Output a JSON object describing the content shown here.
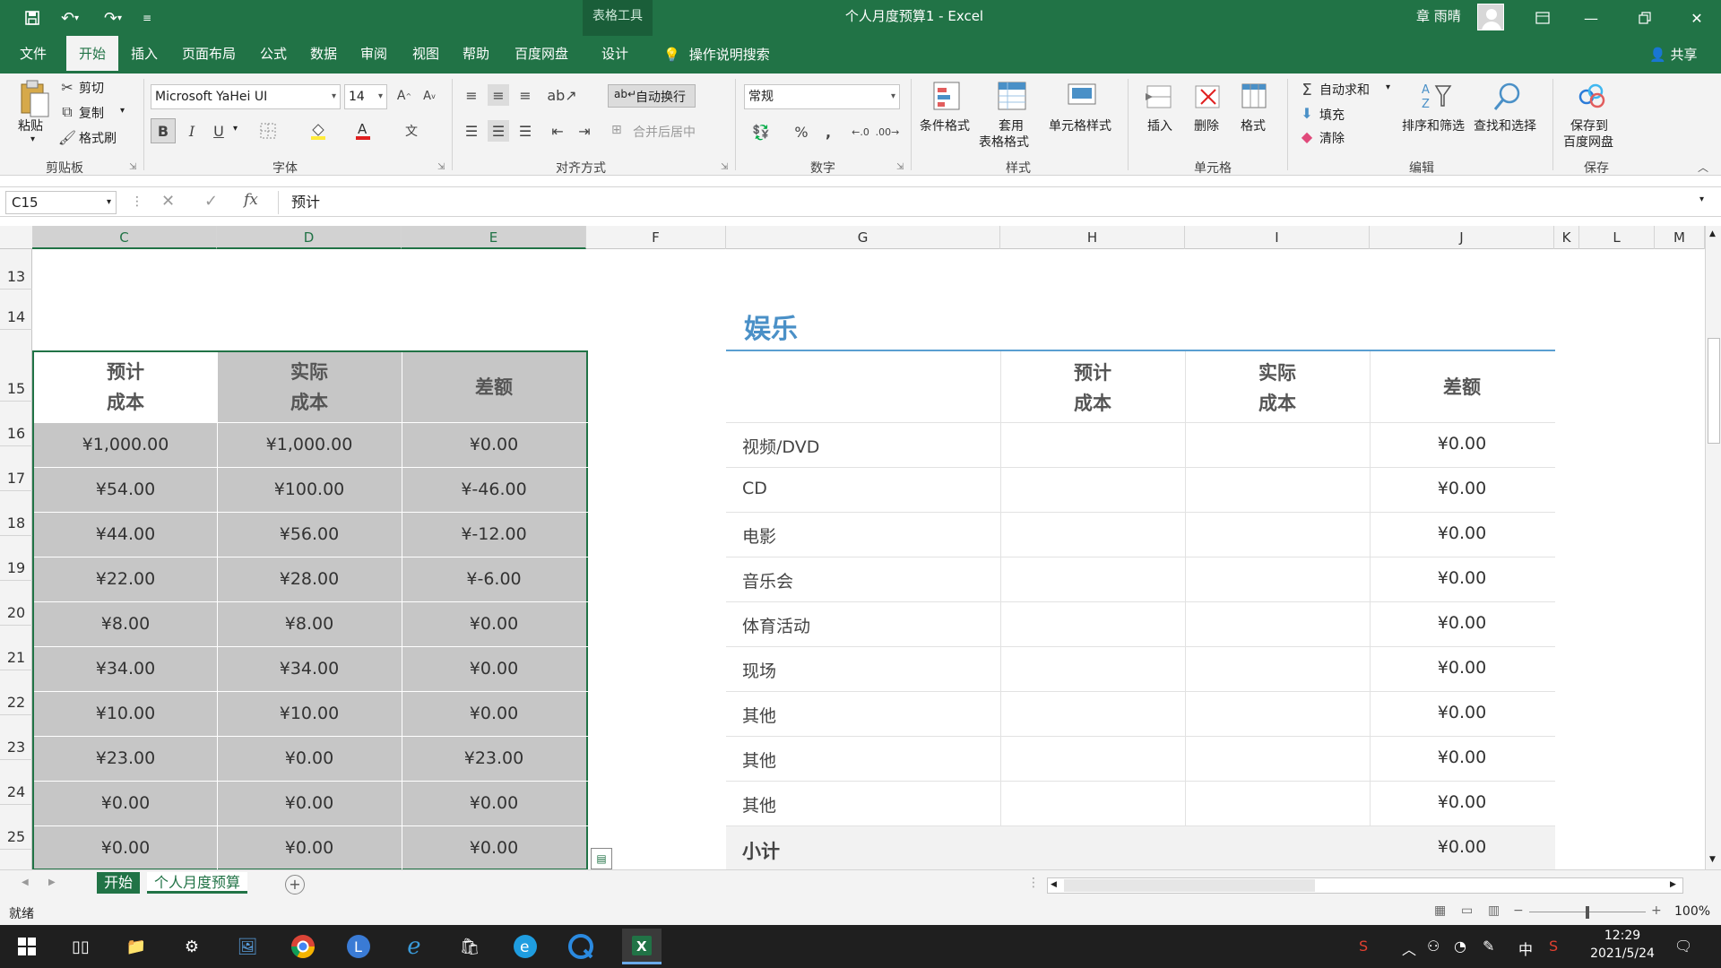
{
  "titlebar": {
    "context_tab": "表格工具",
    "document_title": "个人月度预算1 - Excel",
    "user_name": "章 雨晴"
  },
  "ribbon_tabs": [
    "文件",
    "开始",
    "插入",
    "页面布局",
    "公式",
    "数据",
    "审阅",
    "视图",
    "帮助",
    "百度网盘",
    "设计"
  ],
  "tell_me": "操作说明搜索",
  "share": "共享",
  "clipboard": {
    "paste": "粘贴",
    "cut": "剪切",
    "copy": "复制",
    "format_painter": "格式刷",
    "label": "剪贴板"
  },
  "font": {
    "name": "Microsoft YaHei UI",
    "size": "14",
    "label": "字体",
    "bold": "B",
    "italic": "I",
    "underline": "U"
  },
  "alignment": {
    "wrap_text": "自动换行",
    "merge_center": "合并后居中",
    "label": "对齐方式"
  },
  "number": {
    "format": "常规",
    "percent": "%",
    "comma": ",",
    "label": "数字"
  },
  "styles": {
    "conditional": "条件格式",
    "table_format_1": "套用",
    "table_format_2": "表格格式",
    "cell_styles": "单元格样式",
    "label": "样式"
  },
  "cells": {
    "insert": "插入",
    "delete": "删除",
    "format": "格式",
    "label": "单元格"
  },
  "editing": {
    "autosum": "自动求和",
    "fill": "填充",
    "clear": "清除",
    "sort_filter": "排序和筛选",
    "find_select": "查找和选择",
    "label": "编辑"
  },
  "save": {
    "save_baidu_1": "保存到",
    "save_baidu_2": "百度网盘",
    "label": "保存"
  },
  "formula_bar": {
    "name_box": "C15",
    "fx": "fx",
    "content": "预计"
  },
  "columns": [
    "C",
    "D",
    "E",
    "F",
    "G",
    "H",
    "I",
    "J",
    "K",
    "L",
    "M"
  ],
  "rows": [
    "13",
    "14",
    "15",
    "16",
    "17",
    "18",
    "19",
    "20",
    "21",
    "22",
    "23",
    "24",
    "25"
  ],
  "left_table": {
    "headers": [
      {
        "line1": "预计",
        "line2": "成本"
      },
      {
        "line1": "实际",
        "line2": "成本"
      },
      {
        "line1": "差额",
        "line2": ""
      }
    ],
    "rows": [
      [
        "¥1,000.00",
        "¥1,000.00",
        "¥0.00"
      ],
      [
        "¥54.00",
        "¥100.00",
        "¥-46.00"
      ],
      [
        "¥44.00",
        "¥56.00",
        "¥-12.00"
      ],
      [
        "¥22.00",
        "¥28.00",
        "¥-6.00"
      ],
      [
        "¥8.00",
        "¥8.00",
        "¥0.00"
      ],
      [
        "¥34.00",
        "¥34.00",
        "¥0.00"
      ],
      [
        "¥10.00",
        "¥10.00",
        "¥0.00"
      ],
      [
        "¥23.00",
        "¥0.00",
        "¥23.00"
      ],
      [
        "¥0.00",
        "¥0.00",
        "¥0.00"
      ],
      [
        "¥0.00",
        "¥0.00",
        "¥0.00"
      ]
    ]
  },
  "entertainment": {
    "title": "娱乐",
    "headers": [
      {
        "line1": "预计",
        "line2": "成本"
      },
      {
        "line1": "实际",
        "line2": "成本"
      },
      {
        "line1": "差额",
        "line2": ""
      }
    ],
    "items": [
      {
        "label": "视频/DVD",
        "diff": "¥0.00"
      },
      {
        "label": "CD",
        "diff": "¥0.00"
      },
      {
        "label": "电影",
        "diff": "¥0.00"
      },
      {
        "label": "音乐会",
        "diff": "¥0.00"
      },
      {
        "label": "体育活动",
        "diff": "¥0.00"
      },
      {
        "label": "现场",
        "diff": "¥0.00"
      },
      {
        "label": "其他",
        "diff": "¥0.00"
      },
      {
        "label": "其他",
        "diff": "¥0.00"
      },
      {
        "label": "其他",
        "diff": "¥0.00"
      }
    ],
    "subtotal": {
      "label": "小计",
      "diff": "¥0.00"
    }
  },
  "sheets": [
    "开始",
    "个人月度预算"
  ],
  "status": {
    "ready": "就绪",
    "zoom": "100%"
  },
  "taskbar": {
    "ime": "中",
    "time": "12:29",
    "date": "2021/5/24"
  },
  "colors": {
    "excel_green": "#217346",
    "accent_blue": "#4a90c7",
    "selection_gray": "#c6c6c6"
  }
}
